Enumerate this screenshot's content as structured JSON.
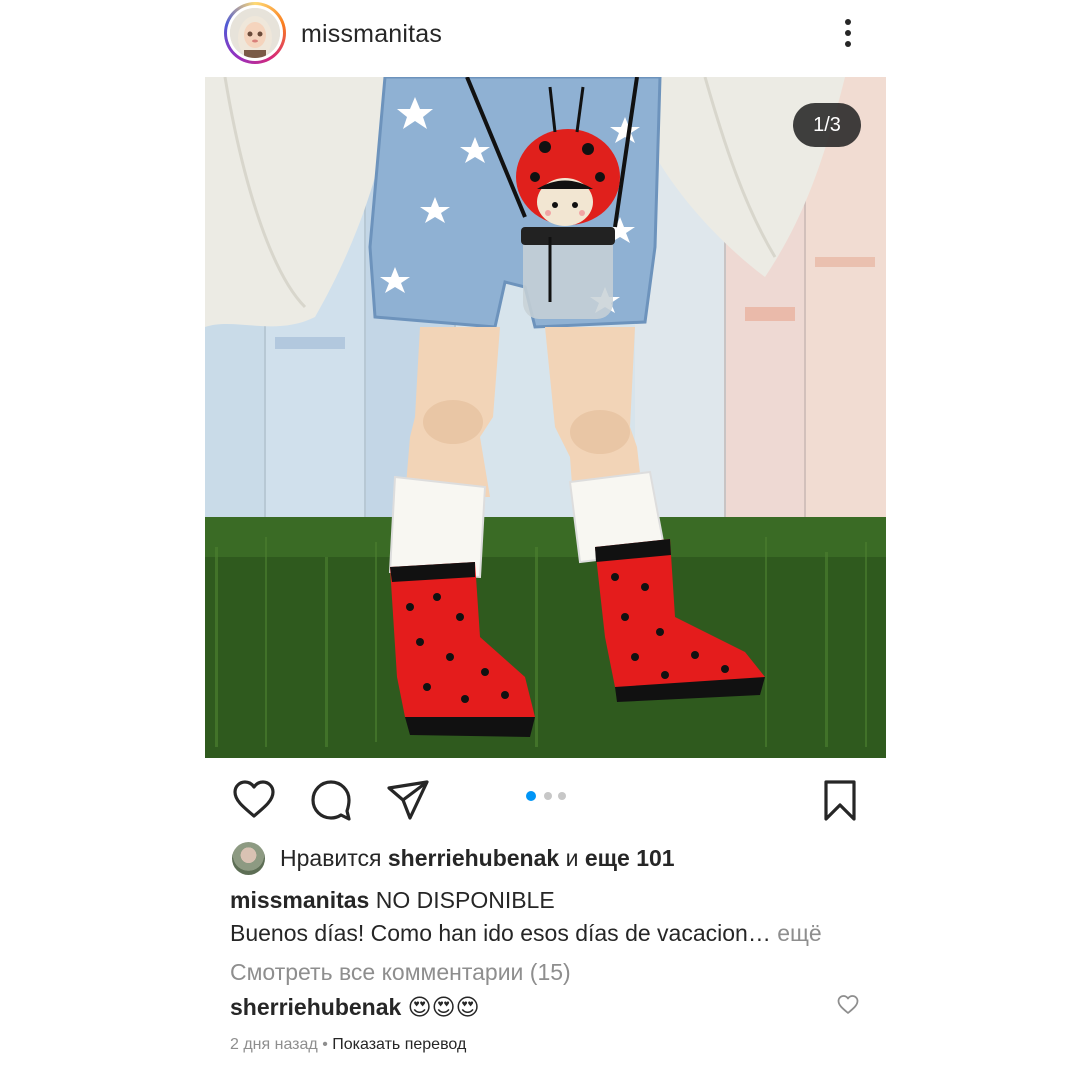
{
  "header": {
    "username": "missmanitas",
    "avatar_icon": "profile-avatar",
    "more_icon": "more-vertical-icon"
  },
  "photo": {
    "counter": "1/3"
  },
  "actions": {
    "like_icon": "heart-icon",
    "comment_icon": "comment-icon",
    "share_icon": "send-icon",
    "save_icon": "bookmark-icon",
    "carousel_total": 3,
    "carousel_active": 1,
    "active_dot_color": "#0095f6"
  },
  "likes": {
    "prefix": "Нравится ",
    "user": "sherriehubenak",
    "conj": " и ",
    "others": "еще 101"
  },
  "caption": {
    "username": "missmanitas",
    "title": " NO DISPONIBLE",
    "text": "Buenos días! Como han ido esos días de vacacion…",
    "more": " ещё"
  },
  "comments": {
    "view_all": "Смотреть все комментарии (15)",
    "first_user": "sherriehubenak",
    "first_text": " 😍😍😍"
  },
  "meta": {
    "time": "2 дня назад",
    "separator": " • ",
    "translate": "Показать перевод"
  }
}
